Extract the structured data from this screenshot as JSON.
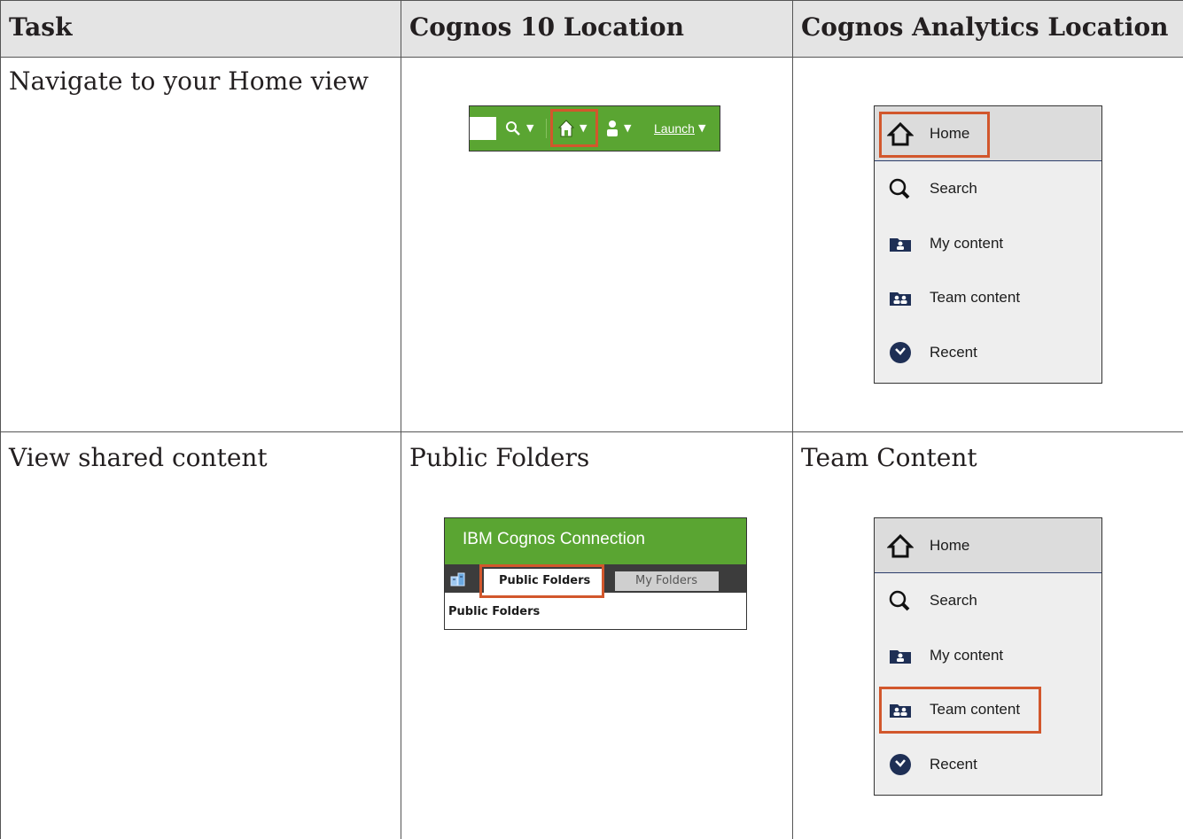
{
  "table": {
    "headers": [
      "Task",
      "Cognos 10 Location",
      "Cognos Analytics Location"
    ],
    "rows": [
      {
        "task": "Navigate to your Home view",
        "cognos10": "",
        "analytics": ""
      },
      {
        "task": "View shared content",
        "cognos10": "Public Folders",
        "analytics": "Team Content"
      }
    ]
  },
  "cognos10_toolbar": {
    "icons": [
      "search-icon",
      "home-icon",
      "user-icon"
    ],
    "launch_label": "Launch",
    "highlighted": "home-icon",
    "bar_color": "#5aa532"
  },
  "analytics_nav": {
    "items": [
      {
        "label": "Home",
        "icon": "home-icon"
      },
      {
        "label": "Search",
        "icon": "search-icon"
      },
      {
        "label": "My content",
        "icon": "my-content-folder-icon"
      },
      {
        "label": "Team content",
        "icon": "team-content-folder-icon"
      },
      {
        "label": "Recent",
        "icon": "recent-clock-icon"
      }
    ]
  },
  "cognos_connection": {
    "title": "IBM Cognos Connection",
    "tabs": [
      "Public Folders",
      "My Folders"
    ],
    "active_tab": "Public Folders",
    "breadcrumb": "Public Folders"
  },
  "colors": {
    "highlight": "#d2572c",
    "header_bg": "#e4e4e4",
    "nav_icon": "#1e2f55"
  }
}
